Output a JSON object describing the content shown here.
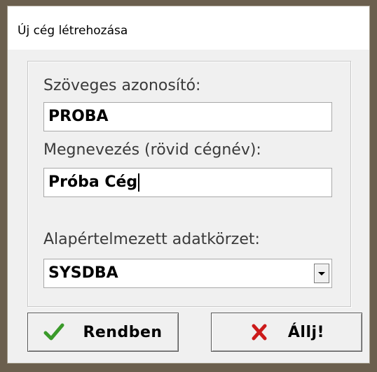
{
  "window": {
    "title": "Új cég létrehozása"
  },
  "form": {
    "text_id_label": "Szöveges azonosító:",
    "text_id_value": "PROBA",
    "name_label": "Megnevezés (rövid cégnév):",
    "name_value": "Próba Cég",
    "area_label": "Alapértelmezett adatkörzet:",
    "area_value": "SYSDBA"
  },
  "buttons": {
    "ok_label": "Rendben",
    "cancel_label": "Állj!",
    "ok_icon": "checkmark-icon",
    "cancel_icon": "x-icon"
  },
  "colors": {
    "ok_icon": "#3a9a2a",
    "cancel_icon": "#cc1a1a"
  }
}
